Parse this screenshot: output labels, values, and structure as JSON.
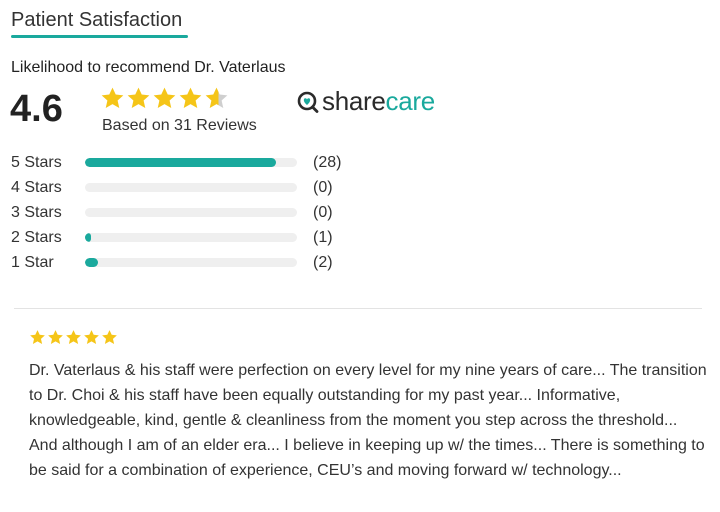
{
  "section": {
    "title": "Patient Satisfaction"
  },
  "colors": {
    "accent": "#1aa99d",
    "star": "#f5c518",
    "star_empty": "#cfcfcf"
  },
  "summary": {
    "recommend_label": "Likelihood to recommend Dr. Vaterlaus",
    "rating": "4.6",
    "rating_value": 4.6,
    "based_on": "Based on 31 Reviews"
  },
  "brand": {
    "name_part1": "share",
    "name_part2": "care",
    "icon": "sharecare-heart-icon"
  },
  "breakdown": [
    {
      "label": "5 Stars",
      "count": "(28)",
      "fraction": 0.9
    },
    {
      "label": "4 Stars",
      "count": "(0)",
      "fraction": 0.0
    },
    {
      "label": "3 Stars",
      "count": "(0)",
      "fraction": 0.0
    },
    {
      "label": "2 Stars",
      "count": "(1)",
      "fraction": 0.03
    },
    {
      "label": "1 Star",
      "count": "(2)",
      "fraction": 0.06
    }
  ],
  "review": {
    "rating": 5,
    "text": "Dr. Vaterlaus & his staff were perfection on every level for my nine years of care... The transition to Dr. Choi & his staff have been equally outstanding for my past year... Informative, knowledgeable, kind, gentle & cleanliness from the moment you step across the threshold... And although I am of an elder era... I believe in keeping up w/ the times... There is something to be said for a combination of experience, CEU’s and moving forward w/ technology..."
  }
}
